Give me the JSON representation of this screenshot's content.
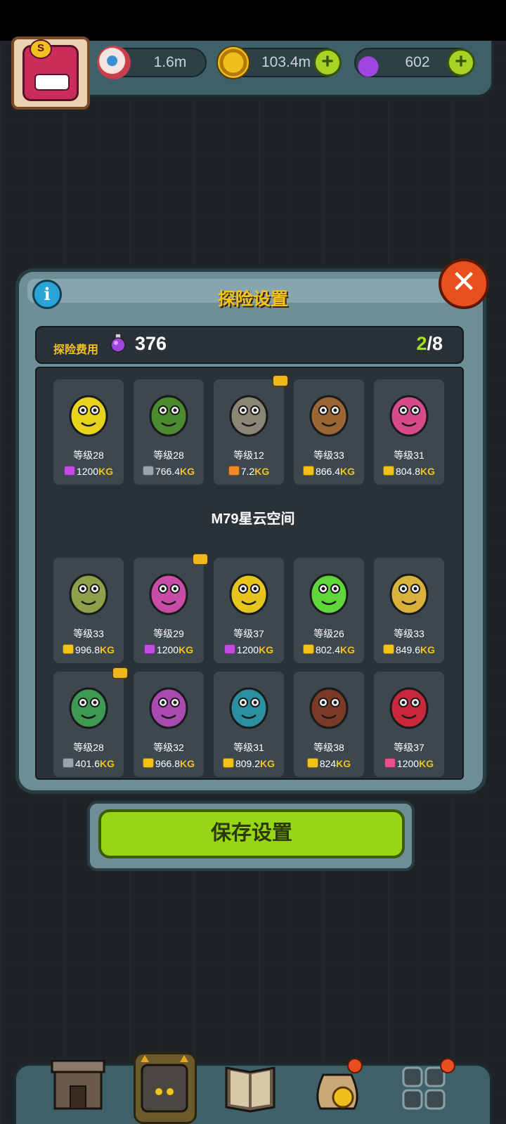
{
  "resources": {
    "eyeballs": "1.6m",
    "coins": "103.4m",
    "potions": "602",
    "plus": "+",
    "badge_letter": "S"
  },
  "dialog": {
    "title": "探险设置",
    "info": "i",
    "close": "✕",
    "cost_label": "探险费用",
    "cost_value": "376",
    "slots_used": "2",
    "slots_total": "/8",
    "section_label": "M79星云空间",
    "save_button": "保存设置"
  },
  "monsters_top": [
    {
      "level": "等级28",
      "weight": "1200",
      "bag": "#c34be0",
      "body": "#e7d51c"
    },
    {
      "level": "等级28",
      "weight": "766.4",
      "bag": "#9aa4a8",
      "body": "#4b8a2e"
    },
    {
      "level": "等级12",
      "weight": "7.2",
      "bag": "#f0892a",
      "body": "#8a8676",
      "marked": true
    },
    {
      "level": "等级33",
      "weight": "866.4",
      "bag": "#f3c21a",
      "body": "#9b6534"
    },
    {
      "level": "等级31",
      "weight": "804.8",
      "bag": "#f3c21a",
      "body": "#d84a8a"
    }
  ],
  "monsters_nebula": [
    {
      "level": "等级33",
      "weight": "996.8",
      "bag": "#f3c21a",
      "body": "#8fa04a"
    },
    {
      "level": "等级29",
      "weight": "1200",
      "bag": "#c34be0",
      "body": "#c84ca8",
      "marked": true
    },
    {
      "level": "等级37",
      "weight": "1200",
      "bag": "#c34be0",
      "body": "#e7c51c"
    },
    {
      "level": "等级26",
      "weight": "802.4",
      "bag": "#f3c21a",
      "body": "#5fd63a"
    },
    {
      "level": "等级33",
      "weight": "849.6",
      "bag": "#f3c21a",
      "body": "#d8b23a"
    },
    {
      "level": "等级28",
      "weight": "401.6",
      "bag": "#9aa4a8",
      "body": "#3c9a52",
      "marked": true
    },
    {
      "level": "等级32",
      "weight": "966.8",
      "bag": "#f3c21a",
      "body": "#a84ab0"
    },
    {
      "level": "等级31",
      "weight": "809.2",
      "bag": "#f3c21a",
      "body": "#2a8fa0"
    },
    {
      "level": "等级38",
      "weight": "824",
      "bag": "#f3c21a",
      "body": "#7a3a26"
    },
    {
      "level": "等级37",
      "weight": "1200",
      "bag": "#e8508a",
      "body": "#c8283a"
    }
  ],
  "kg_unit": "KG",
  "nav": [
    "shop-icon",
    "monster-lair-icon",
    "book-icon",
    "coin-bag-icon",
    "grid-icon"
  ],
  "colors": {
    "accent_yellow": "#f3c21a",
    "save_green": "#96d614",
    "close_red": "#e8501e"
  }
}
